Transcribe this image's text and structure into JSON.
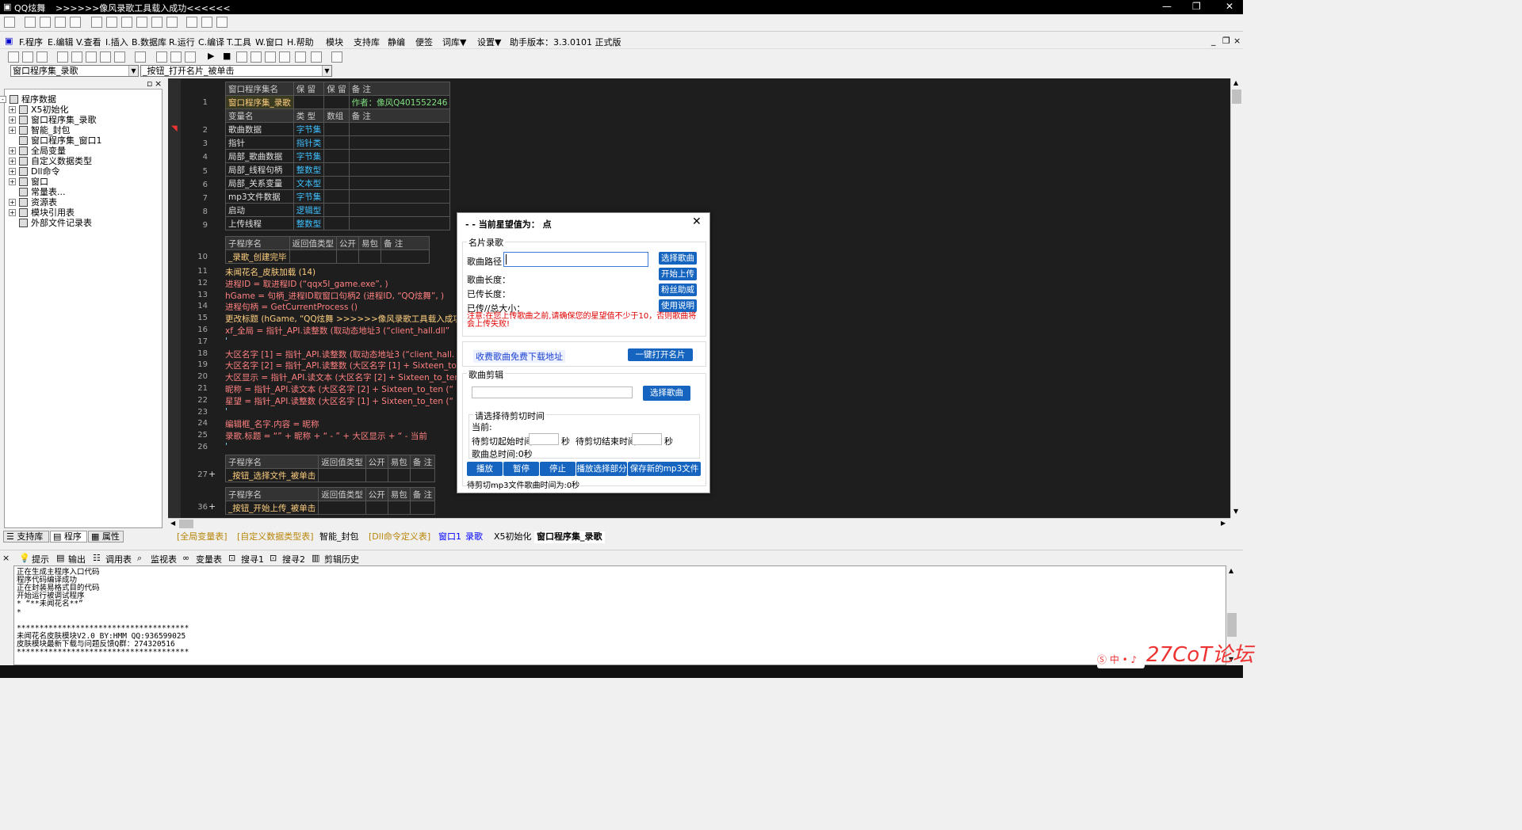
{
  "window": {
    "app_title": "QQ炫舞",
    "status_title": ">>>>>>像风录歌工具载入成功<<<<<<"
  },
  "menu": [
    "F.程序",
    "E.编辑",
    "V.查看",
    "I.插入",
    "B.数据库",
    "R.运行",
    "C.编译",
    "T.工具",
    "W.窗口",
    "H.帮助",
    "模块",
    "支持库",
    "静编",
    "便签",
    "词库▼",
    "设置▼",
    "助手版本：3.3.0101 正式版"
  ],
  "combos": {
    "left": "窗口程序集_录歌",
    "right": "_按钮_打开名片_被单击"
  },
  "tree": [
    {
      "label": "程序数据",
      "pm": "-"
    },
    {
      "label": "X5初始化",
      "pm": "+"
    },
    {
      "label": "窗口程序集_录歌",
      "pm": "+"
    },
    {
      "label": "智能_封包",
      "pm": "+"
    },
    {
      "label": "窗口程序集_窗口1",
      "pm": ""
    },
    {
      "label": "全局变量",
      "pm": "+"
    },
    {
      "label": "自定义数据类型",
      "pm": "+"
    },
    {
      "label": "Dll命令",
      "pm": "+"
    },
    {
      "label": "窗口",
      "pm": "+"
    },
    {
      "label": "常量表...",
      "pm": ""
    },
    {
      "label": "资源表",
      "pm": "+"
    },
    {
      "label": "模块引用表",
      "pm": "+"
    },
    {
      "label": "外部文件记录表",
      "pm": ""
    }
  ],
  "left_tabs": [
    "支持库",
    "程序",
    "属性"
  ],
  "prog_header": {
    "c1": "窗口程序集名",
    "c2": "保 留",
    "c3": "保 留",
    "c4": "备 注"
  },
  "prog_row": {
    "name": "窗口程序集_录歌",
    "note": "作者：像风Q401552246"
  },
  "var_header": {
    "c1": "变量名",
    "c2": "类 型",
    "c3": "数组",
    "c4": "备 注"
  },
  "vars": [
    {
      "ln": "2",
      "name": "歌曲数据",
      "type": "字节集"
    },
    {
      "ln": "3",
      "name": "指针",
      "type": "指针类"
    },
    {
      "ln": "4",
      "name": "局部_歌曲数据",
      "type": "字节集"
    },
    {
      "ln": "5",
      "name": "局部_线程句柄",
      "type": "整数型"
    },
    {
      "ln": "6",
      "name": "局部_关系变量",
      "type": "文本型"
    },
    {
      "ln": "7",
      "name": "mp3文件数据",
      "type": "字节集"
    },
    {
      "ln": "8",
      "name": "启动",
      "type": "逻辑型"
    },
    {
      "ln": "9",
      "name": "上传线程",
      "type": "整数型"
    }
  ],
  "sub_header": {
    "c1": "子程序名",
    "c2": "返回值类型",
    "c3": "公开",
    "c4": "易包",
    "c5": "备 注"
  },
  "sub1": "_录歌_创建完毕",
  "code_lines": [
    {
      "ln": "11",
      "text": "未闻花名_皮肤加载 (14)"
    },
    {
      "ln": "12",
      "text": "进程ID = 取进程ID (“qqx5l_game.exe”, )"
    },
    {
      "ln": "13",
      "text": "hGame = 句柄_进程ID取窗口句柄2 (进程ID, “QQ炫舞”, )"
    },
    {
      "ln": "14",
      "text": "进程句柄 = GetCurrentProcess ()"
    },
    {
      "ln": "15",
      "text": "更改标题 (hGame, “QQ炫舞    >>>>>>像风录歌工具载入成功<<<<<"
    },
    {
      "ln": "16",
      "text": "xf_全局 = 指针_API.读整数 (取动态地址3 (“client_hall.dll”"
    },
    {
      "ln": "17",
      "text": "'"
    },
    {
      "ln": "18",
      "text": "大区名字 [1] = 指针_API.读整数 (取动态地址3 (“client_hall."
    },
    {
      "ln": "19",
      "text": "大区名字 [2] = 指针_API.读整数 (大区名字 [1] + Sixteen_to"
    },
    {
      "ln": "20",
      "text": "大区显示 = 指针_API.读文本 (大区名字 [2] + Sixteen_to_ten"
    },
    {
      "ln": "21",
      "text": "昵称 = 指针_API.读文本 (大区名字 [2] + Sixteen_to_ten (“"
    },
    {
      "ln": "22",
      "text": "星望 = 指针_API.读整数 (大区名字 [1] + Sixteen_to_ten (“"
    },
    {
      "ln": "23",
      "text": "'"
    },
    {
      "ln": "24",
      "text": "编辑框_名字.内容 = 昵称"
    },
    {
      "ln": "25",
      "text": "录歌.标题 = “” + 昵称 + “ - ” + 大区显示 + “ - 当前"
    },
    {
      "ln": "26",
      "text": "'"
    }
  ],
  "sub2": "_按钮_选择文件_被单击",
  "sub2_ln": "27",
  "sub3": "_按钮_开始上传_被单击",
  "sub3_ln": "36",
  "editor_tabs": [
    "[全局变量表]",
    "[自定义数据类型表]",
    "智能_封包",
    "[Dll命令定义表]",
    "窗口1",
    "录歌",
    "X5初始化",
    "窗口程序集_录歌"
  ],
  "bottom_tabs": [
    "提示",
    "输出",
    "调用表",
    "监视表",
    "变量表",
    "搜寻1",
    "搜寻2",
    "剪辑历史"
  ],
  "output_lines": [
    "正在生成主程序入口代码",
    "程序代码编译成功",
    "正在封装易格式目的代码",
    "开始运行被调试程序",
    "* “**未闻花名**”",
    "*",
    "",
    "**************************************",
    "未闻花名皮肤模块V2.0 BY:HMM QQ:936599025",
    "皮肤模块最新下载与问题反馈Q群：274320516",
    "**************************************"
  ],
  "dialog": {
    "title": "- - 当前星望值为： 点",
    "group1": "名片录歌",
    "path_label": "歌曲路径：",
    "btn_select": "选择歌曲",
    "len_label": "歌曲长度：",
    "btn_upload": "开始上传",
    "uploaded_label": "已传长度：",
    "btn_fans": "粉丝助威",
    "ratio_label": "已传//总大小：",
    "btn_help": "使用说明",
    "warning": "注意:在您上传歌曲之前,请确保您的星望值不少于10，否则歌曲将会上传失败!",
    "free_link": "收费歌曲免费下载地址",
    "btn_card": "一键打开名片",
    "group2": "歌曲剪辑",
    "btn_select2": "选择歌曲",
    "time_group": "请选择待剪切时间",
    "current": "当前:",
    "start_label": "待剪切起始时间",
    "sec1": "秒",
    "end_label": "待剪切结束时间",
    "sec2": "秒",
    "total": "歌曲总时间:0秒",
    "btns": [
      "播放",
      "暂停",
      "停止",
      "播放选择部分",
      "保存新的mp3文件"
    ],
    "footer": "待剪切mp3文件歌曲时间为:0秒"
  },
  "watermark": "27CoT论坛"
}
